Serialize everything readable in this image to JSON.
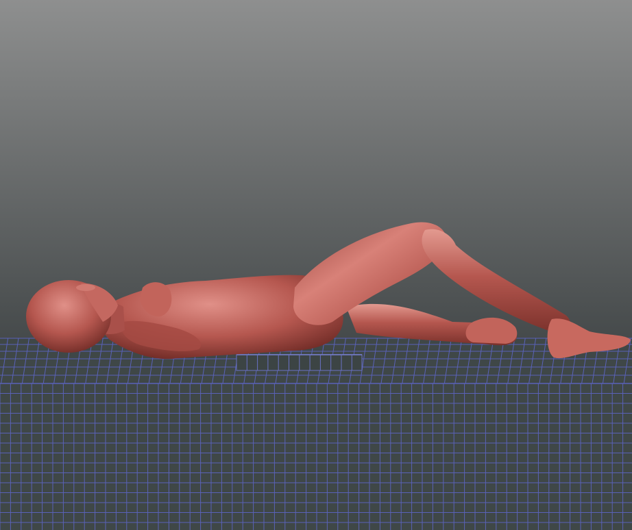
{
  "viewport": {
    "name": "3d-viewport",
    "background_top_color": "#8e8f8f",
    "background_bottom_color": "#3c4142",
    "floor_color": "#3f4747",
    "grid_line_color": "#5a62b8",
    "figure_skin_color": "#b5574f",
    "figure_highlight_color": "#e09088",
    "figure_shadow_color": "#6e2a25",
    "block_color": "#3c4444",
    "block_outline_color": "#6a72c6",
    "grid_visible": true
  },
  "scene": {
    "objects": [
      {
        "name": "reclining-figure-model",
        "description_icon": "mannequin"
      },
      {
        "name": "support-block",
        "description_icon": "box"
      },
      {
        "name": "ground-grid-plane",
        "description_icon": "grid"
      }
    ]
  }
}
